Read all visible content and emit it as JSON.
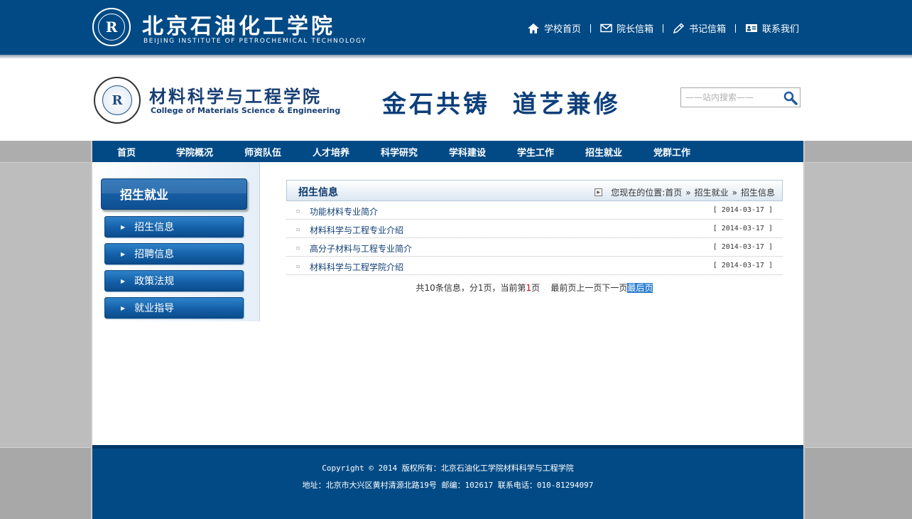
{
  "top": {
    "school_name": "北京石油化工学院",
    "school_en": "BEIJING INSTITUTE OF PETROCHEMICAL TECHNOLOGY",
    "links": [
      {
        "label": "学校首页",
        "icon": "home-icon"
      },
      {
        "label": "院长信箱",
        "icon": "mail-icon"
      },
      {
        "label": "书记信箱",
        "icon": "pencil-icon"
      },
      {
        "label": "联系我们",
        "icon": "contact-card-icon"
      }
    ]
  },
  "header": {
    "college_name": "材料科学与工程学院",
    "college_en": "College of Materials Science & Engineering",
    "motto": "金石共铸  道艺兼修",
    "search_placeholder": "——站内搜索——"
  },
  "nav": [
    "首页",
    "学院概况",
    "师资队伍",
    "人才培养",
    "科学研究",
    "学科建设",
    "学生工作",
    "招生就业",
    "党群工作"
  ],
  "sidebar": {
    "title": "招生就业",
    "items": [
      "招生信息",
      "招聘信息",
      "政策法规",
      "就业指导"
    ]
  },
  "content": {
    "title": "招生信息",
    "breadcrumb": {
      "prefix": "您现在的位置:",
      "items": [
        "首页",
        "招生就业",
        "招生信息"
      ],
      "separator": "»"
    },
    "rows": [
      {
        "title": "功能材料专业简介",
        "date": "[ 2014-03-17 ]"
      },
      {
        "title": "材料科学与工程专业介绍",
        "date": "[ 2014-03-17 ]"
      },
      {
        "title": "高分子材料与工程专业简介",
        "date": "[ 2014-03-17 ]"
      },
      {
        "title": "材料科学与工程学院介绍",
        "date": "[ 2014-03-17 ]"
      }
    ],
    "pager": {
      "summary_a": "共10条信息，分1页，当前第",
      "current": "1",
      "summary_b": "页",
      "first": "最前页",
      "prev": "上一页",
      "next": "下一页",
      "last": "最后页"
    }
  },
  "footer": {
    "copyright": "Copyright © 2014 版权所有：北京石油化工学院材料科学与工程学院",
    "address": "地址：北京市大兴区黄村清源北路19号 邮编：102617  联系电话：010-81294097"
  },
  "colors": {
    "brand_blue": "#024a85",
    "side_grey": "#bdbdbd"
  }
}
